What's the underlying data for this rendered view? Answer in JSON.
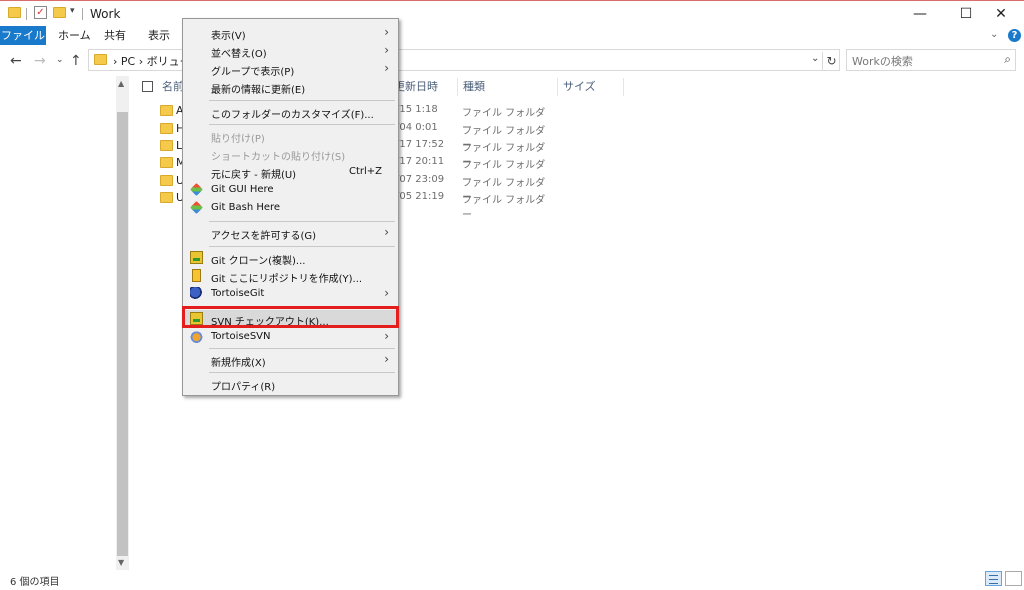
{
  "window": {
    "title": "Work",
    "minimize": "—",
    "maximize": "☐",
    "close": "✕"
  },
  "ribbon": {
    "tabs": [
      "ファイル",
      "ホーム",
      "共有",
      "表示"
    ],
    "expand": "⌄",
    "help": "?"
  },
  "address": {
    "path": "› PC › ボリューム",
    "refresh": "↻",
    "search_placeholder": "Workの検索"
  },
  "columns": {
    "name": "名前",
    "date": "更新日時",
    "type": "種類",
    "size": "サイズ"
  },
  "files": [
    {
      "name": "A",
      "date": "/15 1:18",
      "type": "ファイル フォルダー"
    },
    {
      "name": "H",
      "date": "/04 0:01",
      "type": "ファイル フォルダー"
    },
    {
      "name": "L",
      "date": "/17 17:52",
      "type": "ファイル フォルダー"
    },
    {
      "name": "M",
      "date": "/17 20:11",
      "type": "ファイル フォルダー"
    },
    {
      "name": "U",
      "date": "/07 23:09",
      "type": "ファイル フォルダー"
    },
    {
      "name": "U",
      "date": "/05 21:19",
      "type": "ファイル フォルダー"
    }
  ],
  "status": {
    "item_count": "6 個の項目"
  },
  "context_menu": {
    "items": [
      {
        "label": "表示(V)",
        "submenu": true
      },
      {
        "label": "並べ替え(O)",
        "submenu": true
      },
      {
        "label": "グループで表示(P)",
        "submenu": true
      },
      {
        "label": "最新の情報に更新(E)"
      },
      {
        "label": "このフォルダーのカスタマイズ(F)..."
      },
      {
        "label": "貼り付け(P)",
        "disabled": true
      },
      {
        "label": "ショートカットの貼り付け(S)",
        "disabled": true
      },
      {
        "label": "元に戻す - 新規(U)",
        "shortcut": "Ctrl+Z"
      },
      {
        "label": "Git GUI Here",
        "icon": "git-gui-icon"
      },
      {
        "label": "Git Bash Here",
        "icon": "git-bash-icon"
      },
      {
        "label": "アクセスを許可する(G)",
        "submenu": true
      },
      {
        "label": "Git クローン(複製)...",
        "icon": "tortoisegit-clone-icon"
      },
      {
        "label": "Git ここにリポジトリを作成(Y)...",
        "icon": "tortoisegit-create-repo-icon"
      },
      {
        "label": "TortoiseGit",
        "icon": "tortoisegit-icon",
        "submenu": true
      },
      {
        "label": "SVN チェックアウト(K)...",
        "icon": "svn-checkout-icon",
        "highlighted": true
      },
      {
        "label": "TortoiseSVN",
        "icon": "tortoisesvn-icon",
        "submenu": true
      },
      {
        "label": "新規作成(X)",
        "submenu": true
      },
      {
        "label": "プロパティ(R)"
      }
    ]
  }
}
